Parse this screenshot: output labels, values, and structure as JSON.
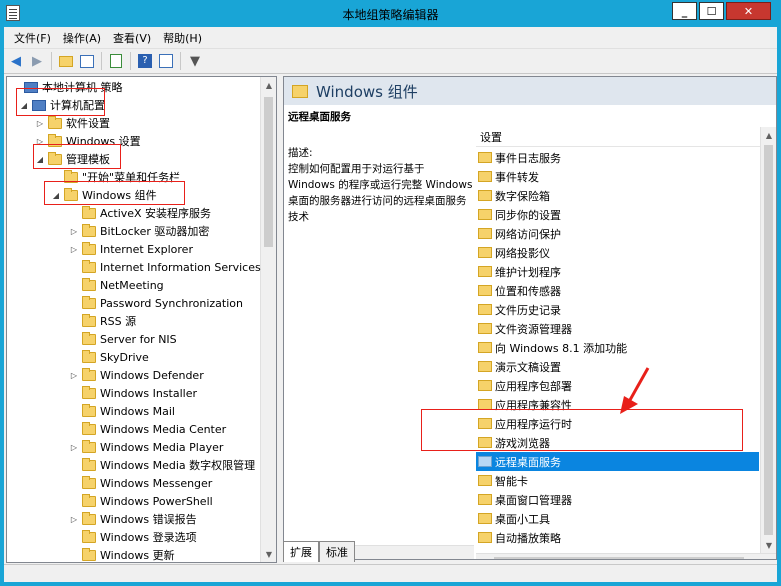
{
  "window": {
    "title": "本地组策略编辑器",
    "minimize_label": "_",
    "maximize_label": "☐",
    "close_label": "✕"
  },
  "menu": [
    "文件(F)",
    "操作(A)",
    "查看(V)",
    "帮助(H)"
  ],
  "tree": {
    "items": [
      {
        "label": "本地计算机 策略",
        "level": 0,
        "icon": "policy",
        "arrow": ""
      },
      {
        "label": "计算机配置",
        "level": 1,
        "icon": "computer",
        "arrow": "expanded"
      },
      {
        "label": "软件设置",
        "level": 2,
        "icon": "folder",
        "arrow": "collapsed"
      },
      {
        "label": "Windows 设置",
        "level": 2,
        "icon": "folder",
        "arrow": "collapsed"
      },
      {
        "label": "管理模板",
        "level": 2,
        "icon": "folder",
        "arrow": "expanded"
      },
      {
        "label": "\"开始\"菜单和任务栏",
        "level": 3,
        "icon": "folder",
        "arrow": ""
      },
      {
        "label": "Windows 组件",
        "level": 3,
        "icon": "folder",
        "arrow": "expanded"
      },
      {
        "label": "ActiveX 安装程序服务",
        "level": 4,
        "icon": "folder",
        "arrow": ""
      },
      {
        "label": "BitLocker 驱动器加密",
        "level": 4,
        "icon": "folder",
        "arrow": "collapsed"
      },
      {
        "label": "Internet Explorer",
        "level": 4,
        "icon": "folder",
        "arrow": "collapsed"
      },
      {
        "label": "Internet Information Services",
        "level": 4,
        "icon": "folder",
        "arrow": ""
      },
      {
        "label": "NetMeeting",
        "level": 4,
        "icon": "folder",
        "arrow": ""
      },
      {
        "label": "Password Synchronization",
        "level": 4,
        "icon": "folder",
        "arrow": ""
      },
      {
        "label": "RSS 源",
        "level": 4,
        "icon": "folder",
        "arrow": ""
      },
      {
        "label": "Server for NIS",
        "level": 4,
        "icon": "folder",
        "arrow": ""
      },
      {
        "label": "SkyDrive",
        "level": 4,
        "icon": "folder",
        "arrow": ""
      },
      {
        "label": "Windows Defender",
        "level": 4,
        "icon": "folder",
        "arrow": "collapsed"
      },
      {
        "label": "Windows Installer",
        "level": 4,
        "icon": "folder",
        "arrow": ""
      },
      {
        "label": "Windows Mail",
        "level": 4,
        "icon": "folder",
        "arrow": ""
      },
      {
        "label": "Windows Media Center",
        "level": 4,
        "icon": "folder",
        "arrow": ""
      },
      {
        "label": "Windows Media Player",
        "level": 4,
        "icon": "folder",
        "arrow": "collapsed"
      },
      {
        "label": "Windows Media 数字权限管理",
        "level": 4,
        "icon": "folder",
        "arrow": ""
      },
      {
        "label": "Windows Messenger",
        "level": 4,
        "icon": "folder",
        "arrow": ""
      },
      {
        "label": "Windows PowerShell",
        "level": 4,
        "icon": "folder",
        "arrow": ""
      },
      {
        "label": "Windows 错误报告",
        "level": 4,
        "icon": "folder",
        "arrow": "collapsed"
      },
      {
        "label": "Windows 登录选项",
        "level": 4,
        "icon": "folder",
        "arrow": ""
      },
      {
        "label": "Windows 更新",
        "level": 4,
        "icon": "folder",
        "arrow": ""
      }
    ]
  },
  "right_pane": {
    "header": "Windows 组件",
    "description": {
      "title": "远程桌面服务",
      "label": "描述:",
      "text": "控制如何配置用于对运行基于 Windows 的程序或运行完整 Windows 桌面的服务器进行访问的远程桌面服务技术"
    },
    "list_header": "设置",
    "items": [
      "事件日志服务",
      "事件转发",
      "数字保险箱",
      "同步你的设置",
      "网络访问保护",
      "网络投影仪",
      "维护计划程序",
      "位置和传感器",
      "文件历史记录",
      "文件资源管理器",
      "向 Windows 8.1 添加功能",
      "演示文稿设置",
      "应用程序包部署",
      "应用程序兼容性",
      "应用程序运行时",
      "游戏浏览器",
      "远程桌面服务",
      "智能卡",
      "桌面窗口管理器",
      "桌面小工具",
      "自动播放策略"
    ],
    "selected_item": "远程桌面服务"
  },
  "tabs": [
    "扩展",
    "标准"
  ],
  "active_tab": "扩展",
  "colors": {
    "title_bar": "#19a5d6",
    "selection": "#0a85e0",
    "annotation": "#e8201a"
  }
}
